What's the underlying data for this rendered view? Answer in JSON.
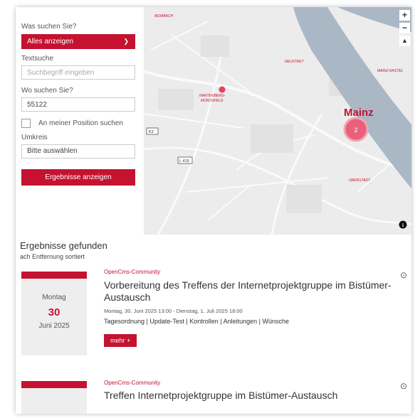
{
  "form": {
    "what_label": "Was suchen Sie?",
    "what_value": "Alles anzeigen",
    "text_label": "Textsuche",
    "text_placeholder": "Suchbegriff eingeben",
    "where_label": "Wo suchen Sie?",
    "where_value": "55122",
    "position_label": "An meiner Position suchen",
    "radius_label": "Umkreis",
    "radius_value": "Bitte auswählen",
    "submit_label": "Ergebnisse anzeigen"
  },
  "map": {
    "zoom_in": "+",
    "zoom_out": "−",
    "city_label": "Mainz",
    "cluster_count": "2",
    "districts": {
      "mombach": "MOMBACH",
      "neustadt": "NEUSTADT",
      "mainz_kastel": "MAINZ-KASTEL",
      "hartenberg_1": "HARTENBERG-",
      "hartenberg_2": "MÜNCHFELD",
      "oberstadt": "OBERSTADT"
    },
    "roads": {
      "k3": "K3",
      "l419": "L 419"
    },
    "info": "i"
  },
  "results": {
    "heading": "Ergebnisse gefunden",
    "sort_note": "ach Entfernung sortiert",
    "items": [
      {
        "category": "OpenCms-Community",
        "title_line1": "Vorbereitung des Treffens der Internetprojektgruppe im Bistümer-",
        "title_line2": "Austausch",
        "meta": "Montag, 30. Juni 2025 13:00 - Dienstag, 1. Juli 2025 18:00",
        "tags": "Tagesordnung | Update-Test | Kontrollen | Anleitungen | Wünsche",
        "more_label": "mehr +",
        "weekday": "Montag",
        "day": "30",
        "month_year": "Juni 2025"
      },
      {
        "category": "OpenCms-Community",
        "title_line1": "Treffen Internetprojektgruppe im Bistümer-Austausch"
      }
    ]
  },
  "colors": {
    "accent": "#c41230",
    "map_bg": "#ececec",
    "river": "#aab8c6"
  }
}
